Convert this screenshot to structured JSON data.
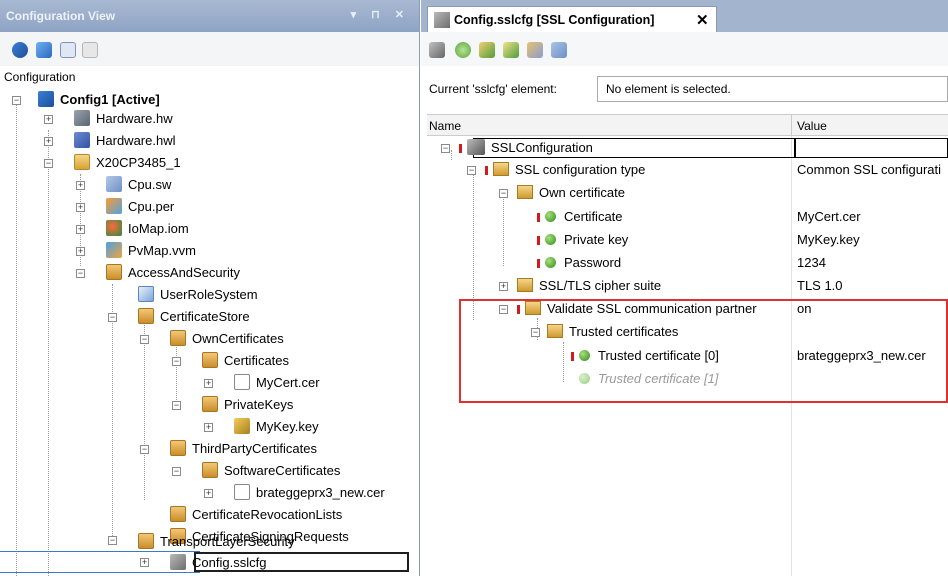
{
  "left_panel": {
    "title": "Configuration View",
    "window_controls": "▾ ⊓ ✕",
    "label": "Configuration",
    "tree": [
      {
        "label": "Config1 [Active]",
        "icon": "config-icon",
        "bold": true
      },
      {
        "label": "Hardware.hw",
        "icon": "hardware-icon"
      },
      {
        "label": "Hardware.hwl",
        "icon": "hardware-list-icon"
      },
      {
        "label": "X20CP3485_1",
        "icon": "folder-icon"
      },
      {
        "label": "Cpu.sw",
        "icon": "cpu-software-icon"
      },
      {
        "label": "Cpu.per",
        "icon": "cpu-permanent-icon"
      },
      {
        "label": "IoMap.iom",
        "icon": "iomap-icon"
      },
      {
        "label": "PvMap.vvm",
        "icon": "pvmap-icon"
      },
      {
        "label": "AccessAndSecurity",
        "icon": "security-folder-icon"
      },
      {
        "label": "UserRoleSystem",
        "icon": "user-role-icon"
      },
      {
        "label": "CertificateStore",
        "icon": "security-folder-icon"
      },
      {
        "label": "OwnCertificates",
        "icon": "security-folder-icon"
      },
      {
        "label": "Certificates",
        "icon": "security-folder-icon"
      },
      {
        "label": "MyCert.cer",
        "icon": "certificate-icon"
      },
      {
        "label": "PrivateKeys",
        "icon": "security-folder-icon"
      },
      {
        "label": "MyKey.key",
        "icon": "key-icon"
      },
      {
        "label": "ThirdPartyCertificates",
        "icon": "security-folder-icon"
      },
      {
        "label": "SoftwareCertificates",
        "icon": "security-folder-icon"
      },
      {
        "label": "brateggeprx3_new.cer",
        "icon": "certificate-icon"
      },
      {
        "label": "CertificateRevocationLists",
        "icon": "security-folder-icon"
      },
      {
        "label": "CertificateSigningRequests",
        "icon": "security-folder-icon"
      },
      {
        "label": "TransportLayerSecurity",
        "icon": "security-folder-icon"
      },
      {
        "label": "Config.sslcfg",
        "icon": "ssl-config-icon",
        "selected": true
      }
    ]
  },
  "right_panel": {
    "tab": {
      "label": "Config.sslcfg [SSL Configuration]",
      "close": "✕"
    },
    "current_element": {
      "label": "Current 'sslcfg' element:",
      "value": "No element is selected."
    },
    "grid": {
      "columns": [
        "Name",
        "Value"
      ],
      "rows": [
        {
          "name": "SSLConfiguration",
          "value": ""
        },
        {
          "name": "SSL configuration type",
          "value": "Common SSL configurati"
        },
        {
          "name": "Own certificate",
          "value": ""
        },
        {
          "name": "Certificate",
          "value": "MyCert.cer"
        },
        {
          "name": "Private key",
          "value": "MyKey.key"
        },
        {
          "name": "Password",
          "value": "1234"
        },
        {
          "name": "SSL/TLS cipher suite",
          "value": "TLS 1.0"
        },
        {
          "name": "Validate SSL communication partner",
          "value": "on"
        },
        {
          "name": "Trusted certificates",
          "value": ""
        },
        {
          "name": "Trusted certificate [0]",
          "value": "brateggeprx3_new.cer"
        },
        {
          "name": "Trusted certificate [1]",
          "value": ""
        }
      ]
    }
  },
  "colors": {
    "highlight": "#e03030",
    "titlebar": "#9aaecb",
    "required_marker": "#d01c1c"
  }
}
